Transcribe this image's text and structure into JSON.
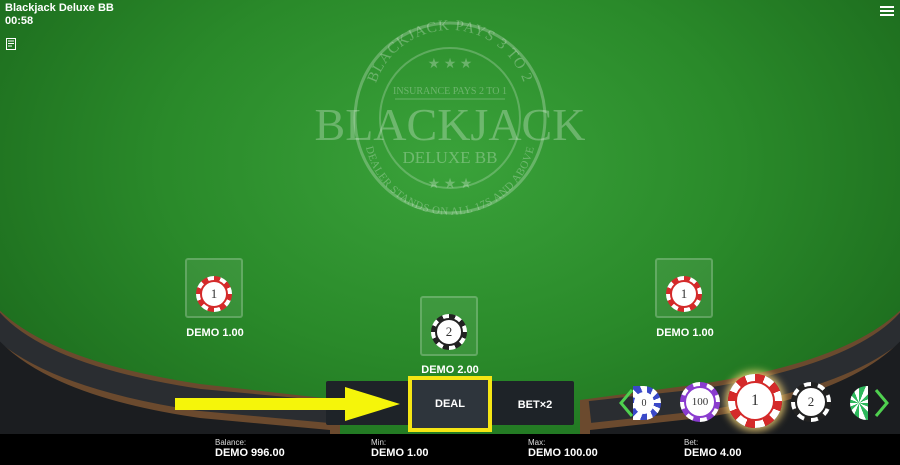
{
  "game": {
    "title": "Blackjack Deluxe BB",
    "timer": "00:58"
  },
  "emblem": {
    "arc_top": "BLACKJACK PAYS 3 TO 2",
    "insurance": "INSURANCE PAYS 2 TO 1",
    "brand": "BLACKJACK",
    "subtitle": "DELUXE BB",
    "arc_bottom": "DEALER STANDS ON ALL 17S AND ABOVE"
  },
  "spots": [
    {
      "chip": "1",
      "amount": "DEMO 1.00"
    },
    {
      "chip": "2",
      "amount": "DEMO 2.00"
    },
    {
      "chip": "1",
      "amount": "DEMO 1.00"
    }
  ],
  "controls": {
    "deal": "DEAL",
    "betx2": "BET×2"
  },
  "chip_rack": [
    "0",
    "100",
    "1",
    "2"
  ],
  "footer": {
    "balance_label": "Balance:",
    "balance": "DEMO 996.00",
    "min_label": "Min:",
    "min": "DEMO 1.00",
    "max_label": "Max:",
    "max": "DEMO 100.00",
    "bet_label": "Bet:",
    "bet": "DEMO 4.00"
  },
  "colors": {
    "felt": "#2a8a2a",
    "highlight": "#f5e514",
    "chip_red": "#d42a2a",
    "chip_purple": "#8a3ccf"
  }
}
